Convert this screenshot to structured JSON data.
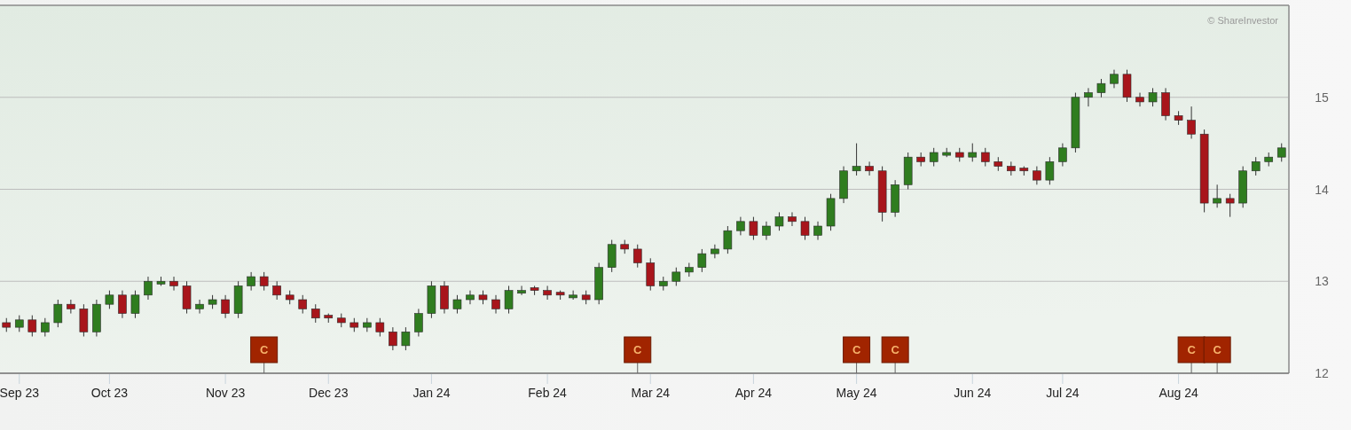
{
  "chart": {
    "copyright": "© ShareInvestor",
    "chart_data": {
      "type": "candlestick",
      "ylim": [
        12,
        16
      ],
      "yticks": [
        12,
        13,
        14,
        15
      ],
      "grid": true,
      "categories": [
        null,
        "Sep 23",
        null,
        null,
        null,
        null,
        null,
        null,
        "Oct 23",
        null,
        null,
        null,
        null,
        null,
        null,
        null,
        null,
        "Nov 23",
        null,
        null,
        null,
        null,
        null,
        null,
        null,
        "Dec 23",
        null,
        null,
        null,
        null,
        null,
        null,
        null,
        "Jan 24",
        null,
        null,
        null,
        null,
        null,
        null,
        null,
        null,
        "Feb 24",
        null,
        null,
        null,
        null,
        null,
        null,
        null,
        "Mar 24",
        null,
        null,
        null,
        null,
        null,
        null,
        null,
        "Apr 24",
        null,
        null,
        null,
        null,
        null,
        null,
        null,
        "May 24",
        null,
        null,
        null,
        null,
        null,
        null,
        null,
        null,
        "Jun 24",
        null,
        null,
        null,
        null,
        null,
        null,
        "Jul 24",
        null,
        null,
        null,
        null,
        null,
        null,
        null,
        null,
        "Aug 24",
        null,
        null,
        null,
        null,
        null,
        null,
        null,
        null
      ],
      "ohlc": [
        [
          12.55,
          12.6,
          12.45,
          12.5
        ],
        [
          12.5,
          12.63,
          12.45,
          12.58
        ],
        [
          12.58,
          12.63,
          12.4,
          12.45
        ],
        [
          12.45,
          12.6,
          12.4,
          12.55
        ],
        [
          12.55,
          12.8,
          12.5,
          12.75
        ],
        [
          12.75,
          12.8,
          12.65,
          12.7
        ],
        [
          12.7,
          12.75,
          12.4,
          12.45
        ],
        [
          12.45,
          12.8,
          12.4,
          12.75
        ],
        [
          12.75,
          12.9,
          12.7,
          12.85
        ],
        [
          12.85,
          12.9,
          12.6,
          12.65
        ],
        [
          12.65,
          12.9,
          12.6,
          12.85
        ],
        [
          12.85,
          13.05,
          12.8,
          13.0
        ],
        [
          12.97,
          13.05,
          12.95,
          13.0
        ],
        [
          13.0,
          13.05,
          12.9,
          12.95
        ],
        [
          12.95,
          13.0,
          12.65,
          12.7
        ],
        [
          12.7,
          12.8,
          12.65,
          12.75
        ],
        [
          12.75,
          12.85,
          12.7,
          12.8
        ],
        [
          12.8,
          12.85,
          12.6,
          12.65
        ],
        [
          12.65,
          13.0,
          12.6,
          12.95
        ],
        [
          12.95,
          13.1,
          12.9,
          13.05
        ],
        [
          13.05,
          13.1,
          12.9,
          12.95
        ],
        [
          12.95,
          13.0,
          12.8,
          12.85
        ],
        [
          12.85,
          12.9,
          12.75,
          12.8
        ],
        [
          12.8,
          12.85,
          12.65,
          12.7
        ],
        [
          12.7,
          12.75,
          12.55,
          12.6
        ],
        [
          12.63,
          12.65,
          12.55,
          12.6
        ],
        [
          12.6,
          12.65,
          12.5,
          12.55
        ],
        [
          12.55,
          12.6,
          12.45,
          12.5
        ],
        [
          12.5,
          12.6,
          12.45,
          12.55
        ],
        [
          12.55,
          12.6,
          12.4,
          12.45
        ],
        [
          12.45,
          12.5,
          12.25,
          12.3
        ],
        [
          12.3,
          12.5,
          12.25,
          12.45
        ],
        [
          12.45,
          12.7,
          12.4,
          12.65
        ],
        [
          12.65,
          13.0,
          12.6,
          12.95
        ],
        [
          12.95,
          13.0,
          12.65,
          12.7
        ],
        [
          12.7,
          12.85,
          12.65,
          12.8
        ],
        [
          12.8,
          12.9,
          12.75,
          12.85
        ],
        [
          12.85,
          12.9,
          12.75,
          12.8
        ],
        [
          12.8,
          12.85,
          12.65,
          12.7
        ],
        [
          12.7,
          12.95,
          12.65,
          12.9
        ],
        [
          12.87,
          12.95,
          12.85,
          12.9
        ],
        [
          12.93,
          12.95,
          12.85,
          12.9
        ],
        [
          12.9,
          12.95,
          12.8,
          12.85
        ],
        [
          12.88,
          12.9,
          12.8,
          12.85
        ],
        [
          12.82,
          12.9,
          12.8,
          12.85
        ],
        [
          12.85,
          12.9,
          12.75,
          12.8
        ],
        [
          12.8,
          13.2,
          12.75,
          13.15
        ],
        [
          13.15,
          13.45,
          13.1,
          13.4
        ],
        [
          13.4,
          13.45,
          13.3,
          13.35
        ],
        [
          13.35,
          13.4,
          13.15,
          13.2
        ],
        [
          13.2,
          13.25,
          12.9,
          12.95
        ],
        [
          12.95,
          13.05,
          12.9,
          13.0
        ],
        [
          13.0,
          13.15,
          12.95,
          13.1
        ],
        [
          13.1,
          13.2,
          13.05,
          13.15
        ],
        [
          13.15,
          13.35,
          13.1,
          13.3
        ],
        [
          13.3,
          13.4,
          13.25,
          13.35
        ],
        [
          13.35,
          13.6,
          13.3,
          13.55
        ],
        [
          13.55,
          13.7,
          13.5,
          13.65
        ],
        [
          13.65,
          13.7,
          13.45,
          13.5
        ],
        [
          13.5,
          13.65,
          13.45,
          13.6
        ],
        [
          13.6,
          13.75,
          13.55,
          13.7
        ],
        [
          13.7,
          13.75,
          13.6,
          13.65
        ],
        [
          13.65,
          13.7,
          13.45,
          13.5
        ],
        [
          13.5,
          13.65,
          13.45,
          13.6
        ],
        [
          13.6,
          13.95,
          13.55,
          13.9
        ],
        [
          13.9,
          14.25,
          13.85,
          14.2
        ],
        [
          14.2,
          14.5,
          14.15,
          14.25
        ],
        [
          14.25,
          14.3,
          14.15,
          14.2
        ],
        [
          14.2,
          14.25,
          13.65,
          13.75
        ],
        [
          13.75,
          14.1,
          13.7,
          14.05
        ],
        [
          14.05,
          14.4,
          14.0,
          14.35
        ],
        [
          14.35,
          14.4,
          14.25,
          14.3
        ],
        [
          14.3,
          14.45,
          14.25,
          14.4
        ],
        [
          14.37,
          14.45,
          14.35,
          14.4
        ],
        [
          14.4,
          14.45,
          14.3,
          14.35
        ],
        [
          14.35,
          14.5,
          14.3,
          14.4
        ],
        [
          14.4,
          14.45,
          14.25,
          14.3
        ],
        [
          14.3,
          14.35,
          14.2,
          14.25
        ],
        [
          14.25,
          14.3,
          14.15,
          14.2
        ],
        [
          14.23,
          14.25,
          14.15,
          14.2
        ],
        [
          14.2,
          14.25,
          14.05,
          14.1
        ],
        [
          14.1,
          14.35,
          14.05,
          14.3
        ],
        [
          14.3,
          14.5,
          14.25,
          14.45
        ],
        [
          14.45,
          15.05,
          14.4,
          15.0
        ],
        [
          15.0,
          15.1,
          14.9,
          15.05
        ],
        [
          15.05,
          15.2,
          15.0,
          15.15
        ],
        [
          15.15,
          15.3,
          15.1,
          15.25
        ],
        [
          15.25,
          15.3,
          14.95,
          15.0
        ],
        [
          15.0,
          15.05,
          14.9,
          14.95
        ],
        [
          14.95,
          15.1,
          14.9,
          15.05
        ],
        [
          15.05,
          15.1,
          14.75,
          14.8
        ],
        [
          14.8,
          14.85,
          14.7,
          14.75
        ],
        [
          14.75,
          14.9,
          14.55,
          14.6
        ],
        [
          14.6,
          14.65,
          13.75,
          13.85
        ],
        [
          13.85,
          14.05,
          13.8,
          13.9
        ],
        [
          13.9,
          13.95,
          13.7,
          13.85
        ],
        [
          13.85,
          14.25,
          13.8,
          14.2
        ],
        [
          14.2,
          14.35,
          14.15,
          14.3
        ],
        [
          14.3,
          14.4,
          14.25,
          14.35
        ],
        [
          14.35,
          14.5,
          14.3,
          14.45
        ]
      ]
    },
    "events": [
      {
        "text": "C"
      },
      {
        "text": "C"
      },
      {
        "text": "C"
      },
      {
        "text": "C"
      },
      {
        "text": "C"
      },
      {
        "text": "C"
      }
    ]
  }
}
